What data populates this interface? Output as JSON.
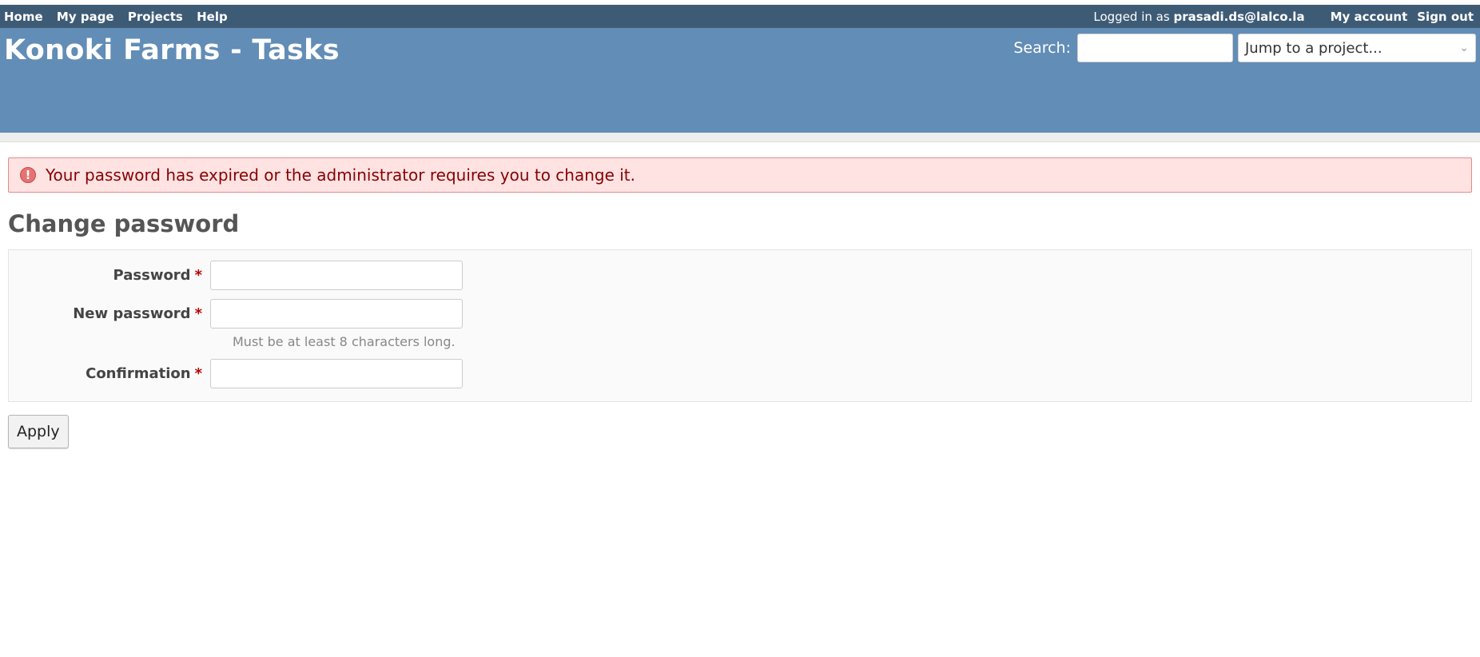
{
  "top_menu": {
    "left_links": [
      "Home",
      "My page",
      "Projects",
      "Help"
    ],
    "logged_in_prefix": "Logged in as",
    "username": "prasadi.ds@lalco.la",
    "my_account": "My account",
    "sign_out": "Sign out"
  },
  "header": {
    "title": "Konoki Farms - Tasks",
    "search_label": "Search:",
    "search_value": "",
    "jump_placeholder": "Jump to a project..."
  },
  "flash": {
    "icon": "error-icon",
    "message": "Your password has expired or the administrator requires you to change it."
  },
  "page": {
    "title": "Change password"
  },
  "form": {
    "password_label": "Password",
    "new_password_label": "New password",
    "new_password_hint": "Must be at least 8 characters long.",
    "confirmation_label": "Confirmation",
    "required_mark": "*",
    "submit": "Apply"
  },
  "colors": {
    "top_menu_bg": "#3e5b76",
    "header_bg": "#628db6",
    "flash_bg": "#ffe3e3",
    "flash_text": "#880000",
    "required": "#bb0000"
  }
}
